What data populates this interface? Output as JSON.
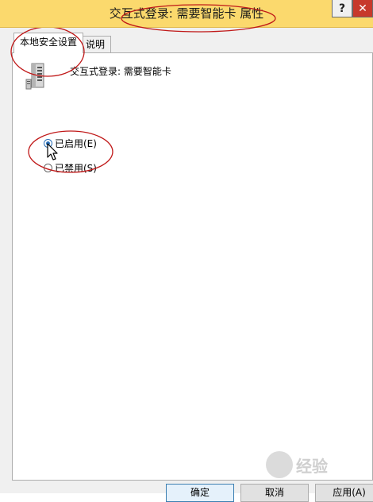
{
  "window": {
    "title": "交互式登录: 需要智能卡 属性",
    "help_label": "?",
    "close_label": "✕"
  },
  "tabs": [
    {
      "label": "本地安全设置",
      "active": true
    },
    {
      "label": "说明",
      "active": false
    }
  ],
  "policy": {
    "name": "交互式登录: 需要智能卡",
    "icon": "server-icon"
  },
  "options": [
    {
      "label": "已启用(E)",
      "checked": true
    },
    {
      "label": "已禁用(S)",
      "checked": false
    }
  ],
  "footer": {
    "ok_label": "确定",
    "cancel_label": "取消",
    "apply_label": "应用(A)"
  },
  "watermark": {
    "text": "经验"
  },
  "colors": {
    "titlebar": "#fbd96d",
    "close_button": "#c7392b",
    "annotation": "#c01818",
    "radio_accent": "#2a6fb8"
  }
}
